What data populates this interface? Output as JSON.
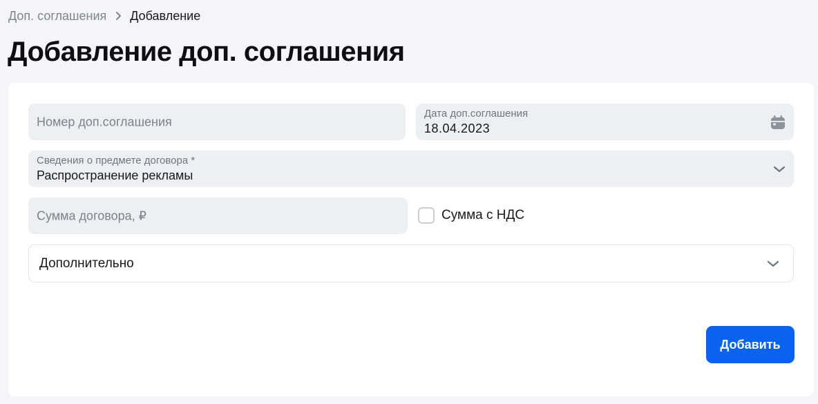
{
  "breadcrumb": {
    "parent": "Доп. соглашения",
    "current": "Добавление"
  },
  "page": {
    "title": "Добавление доп. соглашения"
  },
  "form": {
    "number": {
      "placeholder": "Номер доп.соглашения",
      "value": ""
    },
    "date": {
      "label": "Дата доп.соглашения",
      "value": "18.04.2023",
      "icon": "calendar-icon"
    },
    "subject": {
      "label": "Сведения о предмете договора *",
      "value": "Распространение рекламы",
      "icon": "chevron-down-icon"
    },
    "amount": {
      "placeholder": "Сумма договора, ₽",
      "value": ""
    },
    "vat_checkbox": {
      "label": "Сумма с НДС",
      "checked": false
    },
    "additional": {
      "label": "Дополнительно",
      "expanded": false
    },
    "submit_label": "Добавить"
  },
  "colors": {
    "accent": "#0a63ef",
    "field_bg": "#edf0f3",
    "page_bg": "#f3f5f8"
  }
}
